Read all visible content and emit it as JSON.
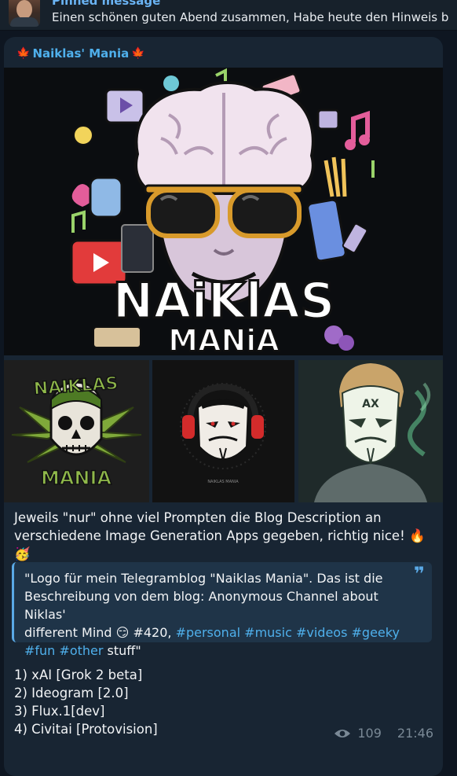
{
  "pinned": {
    "title": "Pinned message",
    "text": "Einen schönen guten Abend zusammen, Habe heute den Hinweis b"
  },
  "post": {
    "channel_name": "Naiklas' Mania",
    "hero_title_line1": "NAiKlAS",
    "hero_title_line2": "MANiA",
    "tile1_text_top": "NAIKLAS",
    "tile1_text_bottom": "MANIA",
    "tile2_caption": "NAIKLAS MANIA",
    "tile3_mask_text": "AX",
    "caption_line1": "Jeweils \"nur\" ohne viel Prompten die Blog Description an",
    "caption_line2": "verschiedene Image Generation Apps gegeben, richtig nice! 🔥🥳",
    "quote": {
      "l1": "\"Logo für mein Telegramblog \"Naiklas Mania\". Das ist die",
      "l2": "Beschreibung von dem blog: Anonymous Channel about Niklas'",
      "l3a": "different Mind 😏 #420, ",
      "tag_personal": "#personal",
      "tag_music": "#music",
      "tag_videos": "#videos",
      "tag_geeky": "#geeky",
      "tag_fun": "#fun",
      "tag_other": "#other",
      "l4b": " stuff\"",
      "mark": "❞"
    },
    "list": [
      "1) xAI [Grok 2 beta]",
      "2) Ideogram [2.0]",
      "3) Flux.1[dev]",
      "4) Civitai [Protovision]"
    ],
    "views": "109",
    "time": "21:46"
  },
  "colors": {
    "background": "#0e1621",
    "bubble": "#182533",
    "link": "#4fb0ec",
    "quote_bg": "#1f3448"
  },
  "icons": [
    "avatar",
    "leaf-icon",
    "quote-icon",
    "eye-icon",
    "reply-icon",
    "more-icon"
  ]
}
